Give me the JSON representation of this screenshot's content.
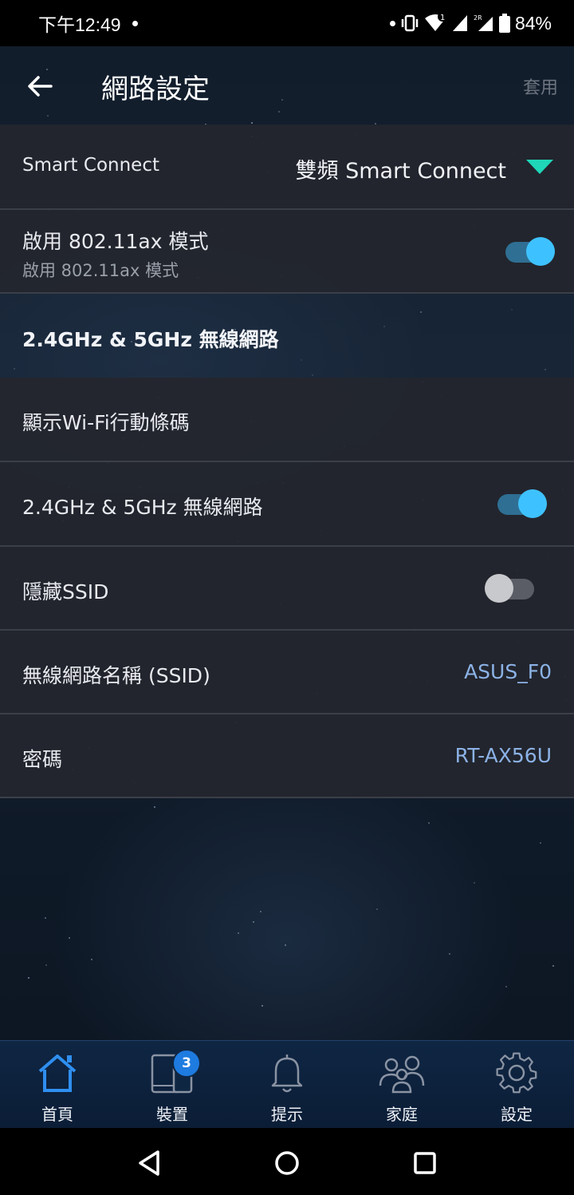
{
  "status_bar": {
    "time": "下午12:49",
    "battery": "84%"
  },
  "app_bar": {
    "title": "網路設定",
    "apply_label": "套用"
  },
  "smart_connect": {
    "label": "Smart Connect",
    "value": "雙頻 Smart Connect"
  },
  "ax_mode": {
    "label": "啟用 802.11ax 模式",
    "sublabel": "啟用 802.11ax 模式",
    "enabled": true
  },
  "section": {
    "title": "2.4GHz & 5GHz 無線網路"
  },
  "rows": {
    "qr_label": "顯示Wi-Fi行動條碼",
    "wireless_label": "2.4GHz & 5GHz 無線網路",
    "hide_ssid_label": "隱藏SSID",
    "ssid_label": "無線網路名稱 (SSID)",
    "ssid_value": "ASUS_F0",
    "password_label": "密碼",
    "password_value": "RT-AX56U"
  },
  "toggles": {
    "wireless_enabled": true,
    "hide_ssid": false
  },
  "bottom_nav": {
    "items": [
      {
        "label": "首頁",
        "icon": "home-icon",
        "active": true
      },
      {
        "label": "裝置",
        "icon": "devices-icon",
        "badge": "3"
      },
      {
        "label": "提示",
        "icon": "bell-icon"
      },
      {
        "label": "家庭",
        "icon": "family-icon"
      },
      {
        "label": "設定",
        "icon": "gear-icon"
      }
    ]
  },
  "colors": {
    "accent": "#3ec2ff",
    "dropdown": "#1fd6b8",
    "link": "#8cb2e6",
    "nav_bg": "#0f2643"
  }
}
